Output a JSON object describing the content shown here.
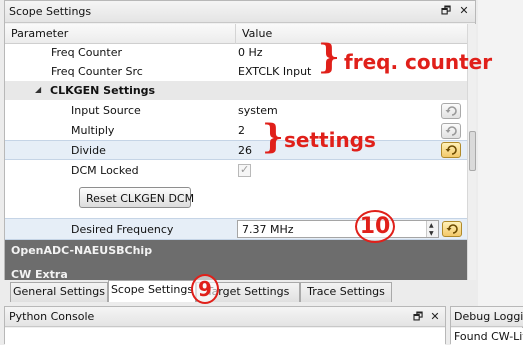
{
  "dock": {
    "title": "Scope Settings",
    "float_glyph": "🗗",
    "close_glyph": "✕"
  },
  "grid": {
    "col_parameter": "Parameter",
    "col_value": "Value",
    "rows": [
      {
        "label": "Freq Counter",
        "value": "0 Hz"
      },
      {
        "label": "Freq Counter Src",
        "value": "EXTCLK Input"
      },
      {
        "label": "CLKGEN Settings",
        "value": ""
      },
      {
        "label": "Input Source",
        "value": "system"
      },
      {
        "label": "Multiply",
        "value": "2"
      },
      {
        "label": "Divide",
        "value": "26"
      },
      {
        "label": "DCM Locked",
        "value": ""
      },
      {
        "label": "Reset CLKGEN DCM",
        "value": ""
      },
      {
        "label": "Desired Frequency",
        "value": "7.37 MHz"
      }
    ],
    "dcm_locked_checked": true,
    "groups": [
      "OpenADC-NAEUSBChip",
      "CW Extra"
    ]
  },
  "tabs": [
    {
      "label": "General Settings",
      "active": false
    },
    {
      "label": "Scope Settings",
      "active": true
    },
    {
      "label": "Target Settings",
      "active": false
    },
    {
      "label": "Trace Settings",
      "active": false
    }
  ],
  "python_console": {
    "title": "Python Console",
    "float_glyph": "🗗",
    "close_glyph": "✕"
  },
  "debug_logging": {
    "title": "Debug Logging",
    "line": "Found CW-Lite"
  },
  "annotations": {
    "freq_counter": "freq. counter",
    "settings": "settings",
    "circle_10": "10",
    "circle_9": "9",
    "color": "#e0201a"
  }
}
